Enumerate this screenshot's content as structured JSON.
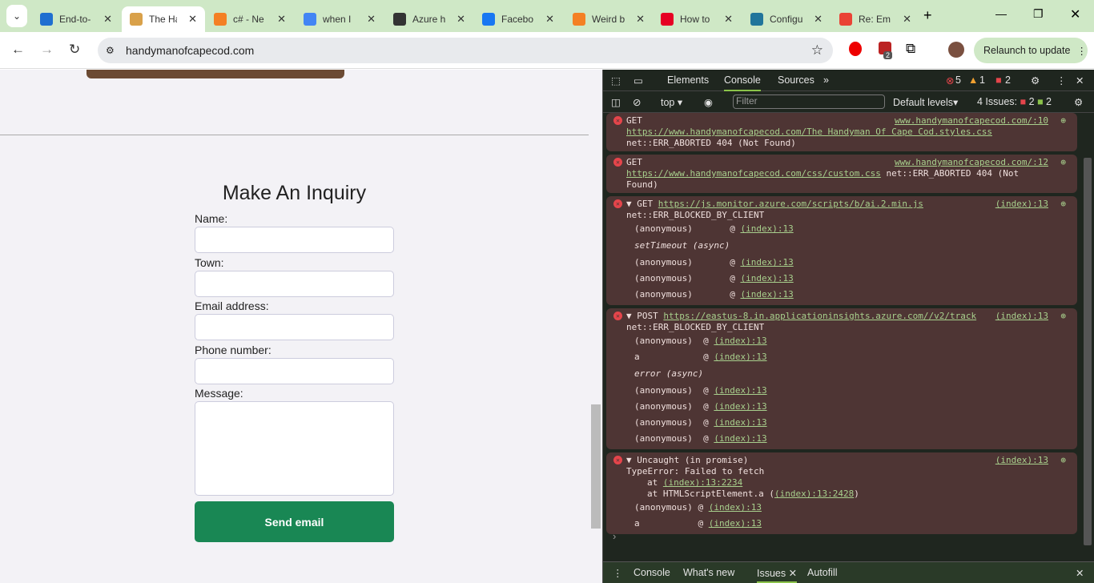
{
  "browser": {
    "tabs": [
      {
        "title": "End-to-",
        "icon": "azure-icon",
        "color": "#1f6fd0"
      },
      {
        "title": "The Ha",
        "icon": "house-icon",
        "color": "#d9a14a",
        "active": true
      },
      {
        "title": "c# - Ne",
        "icon": "stackoverflow-icon",
        "color": "#f48024"
      },
      {
        "title": "when I",
        "icon": "google-icon",
        "color": "#4285f4"
      },
      {
        "title": "Azure h",
        "icon": "azure-bars-icon",
        "color": "#333"
      },
      {
        "title": "Facebo",
        "icon": "facebook-icon",
        "color": "#1877f2"
      },
      {
        "title": "Weird b",
        "icon": "stackoverflow-icon",
        "color": "#f48024"
      },
      {
        "title": "How to",
        "icon": "pinterest-icon",
        "color": "#e60023"
      },
      {
        "title": "Configu",
        "icon": "wordpress-icon",
        "color": "#21759b"
      },
      {
        "title": "Re: Em",
        "icon": "gmail-icon",
        "color": "#ea4335"
      }
    ],
    "url": "handymanofcapecod.com",
    "relaunch": "Relaunch to update",
    "ext_badge": "2"
  },
  "page": {
    "form_title": "Make An Inquiry",
    "fields": [
      {
        "label": "Name:",
        "value": ""
      },
      {
        "label": "Town:",
        "value": ""
      },
      {
        "label": "Email address:",
        "value": ""
      },
      {
        "label": "Phone number:",
        "value": ""
      },
      {
        "label": "Message:",
        "value": ""
      }
    ],
    "submit": "Send email"
  },
  "devtools": {
    "tabs": [
      "Elements",
      "Console",
      "Sources"
    ],
    "active_tab": "Console",
    "errors": "5",
    "warnings": "1",
    "issues_count": "2",
    "context": "top",
    "filter_placeholder": "Filter",
    "levels": "Default levels",
    "issues_label": "4 Issues:",
    "issues_red": "2",
    "issues_green": "2",
    "messages": [
      {
        "head": "GET",
        "src": "www.handymanofcapecod.com/:10",
        "url": "https://www.handymanofcapecod.com/The Handyman Of Cape Cod.styles.css",
        "tail": "net::ERR_ABORTED 404 (Not Found)"
      },
      {
        "head": "GET",
        "src": "www.handymanofcapecod.com/:12",
        "url": "https://www.handymanofcapecod.com/css/custom.css",
        "tail": "net::ERR_ABORTED 404 (Not Found)"
      }
    ],
    "msg3": {
      "head": "▼ GET",
      "url": "https://js.monitor.azure.com/scripts/b/ai.2.min.js",
      "src": "(index):13",
      "line2": "net::ERR_BLOCKED_BY_CLIENT",
      "frames": [
        [
          "(anonymous)",
          "(index):13"
        ],
        [
          "setTimeout (async)",
          ""
        ],
        [
          "(anonymous)",
          "(index):13"
        ],
        [
          "(anonymous)",
          "(index):13"
        ],
        [
          "(anonymous)",
          "(index):13"
        ]
      ]
    },
    "msg4": {
      "head": "▼ POST",
      "url": "https://eastus-8.in.applicationinsights.azure.com//v2/track",
      "src": "(index):13",
      "line2": "net::ERR_BLOCKED_BY_CLIENT",
      "frames": [
        [
          "(anonymous)",
          "(index):13"
        ],
        [
          "a",
          "(index):13"
        ],
        [
          "error (async)",
          ""
        ],
        [
          "(anonymous)",
          "(index):13"
        ],
        [
          "(anonymous)",
          "(index):13"
        ],
        [
          "(anonymous)",
          "(index):13"
        ],
        [
          "(anonymous)",
          "(index):13"
        ]
      ]
    },
    "msg5": {
      "head": "▼ Uncaught (in promise)",
      "src": "(index):13",
      "line2": "TypeError: Failed to fetch",
      "at1": "(index):13:2234",
      "at2pre": "at HTMLScriptElement.a (",
      "at2": "(index):13:2428",
      "at2post": ")",
      "frames": [
        [
          "(anonymous)",
          "(index):13"
        ],
        [
          "a",
          "(index):13"
        ]
      ]
    },
    "drawer_tabs": [
      "Console",
      "What's new",
      "Issues",
      "Autofill"
    ],
    "drawer_active": "Issues"
  }
}
